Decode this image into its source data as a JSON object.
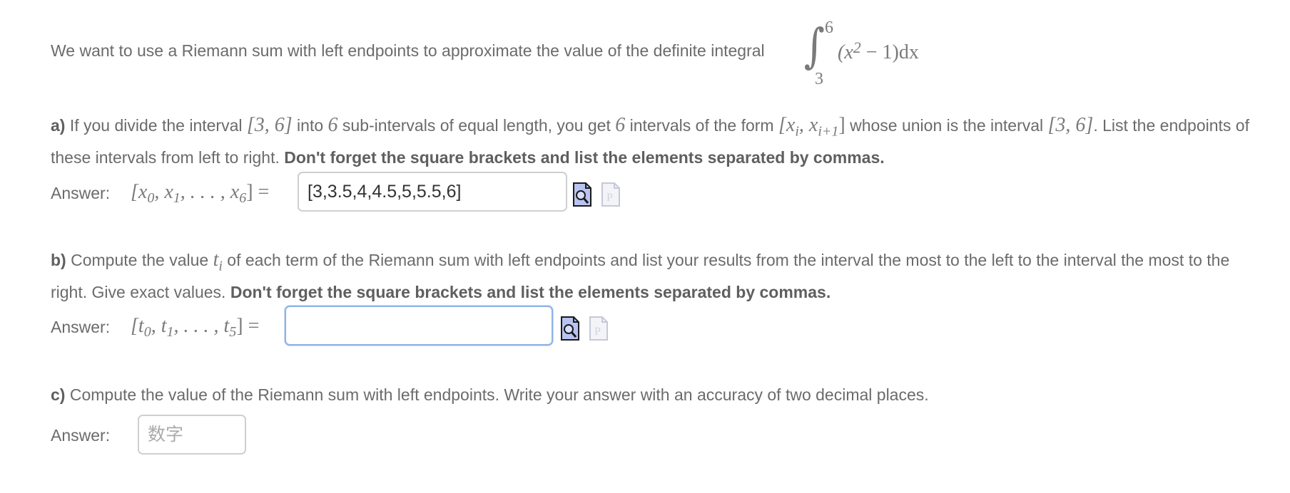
{
  "intro": {
    "text": "We want to use a Riemann sum with left endpoints to approximate the value of the definite integral",
    "integral": {
      "lower": "3",
      "upper": "6",
      "integrand_open": "(x",
      "exponent": "2",
      "integrand_close": " − 1)dx"
    }
  },
  "part_a": {
    "label": "a)",
    "text_1": " If you divide the interval ",
    "interval": "[3, 6]",
    "text_2": " into ",
    "n": "6",
    "text_3": " sub-intervals of equal length, you get ",
    "n2": "6",
    "text_4": " intervals of the form ",
    "form": "[x",
    "form_sub_i": "i",
    "form_mid": ", x",
    "form_sub_i1": "i+1",
    "form_close": "]",
    "text_5": " whose union is the interval ",
    "interval2": "[3, 6]",
    "text_6": ". List the endpoints of these intervals from left to right. ",
    "bold": "Don't forget the square brackets and list the elements separated by commas.",
    "answer_label": "Answer:",
    "answer_math": {
      "open": "[x",
      "s0": "0",
      "m1": ", x",
      "s1": "1",
      "mid": ", . . . , x",
      "s6": "6",
      "close": "] ="
    },
    "input_value": "[3,3.5,4,4.5,5,5.5,6]"
  },
  "part_b": {
    "label": "b)",
    "text_1": " Compute the value ",
    "ti": "t",
    "ti_sub": "i",
    "text_2": " of each term of the Riemann sum with left endpoints and list your results from the interval the most to the left to the interval the most to the right. Give exact values. ",
    "bold": "Don't forget the square brackets and list the elements separated by commas.",
    "answer_label": "Answer:",
    "answer_math": {
      "open": "[t",
      "s0": "0",
      "m1": ", t",
      "s1": "1",
      "mid": ", . . . , t",
      "s5": "5",
      "close": "] ="
    },
    "input_value": ""
  },
  "part_c": {
    "label": "c)",
    "text": " Compute the value of the Riemann sum with left endpoints. Write your answer with an accuracy of two decimal places.",
    "answer_label": "Answer:",
    "input_placeholder": "数字"
  },
  "icons": {
    "preview": "preview-magnifier-icon",
    "pdf": "pdf-document-icon"
  },
  "colors": {
    "text": "#6b6b6b",
    "focus_border": "#8fb3e6",
    "icon_fill": "#b9c3f2"
  }
}
